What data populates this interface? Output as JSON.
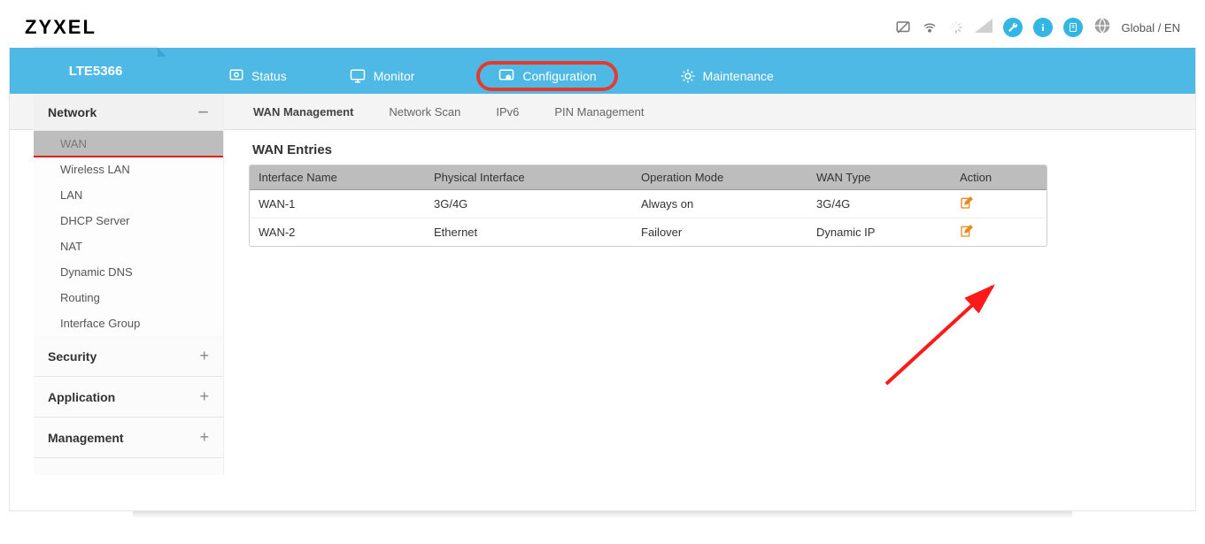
{
  "brand": "ZYXEL",
  "language": "Global / EN",
  "device_name": "LTE5366",
  "main_tabs": {
    "status": "Status",
    "monitor": "Monitor",
    "configuration": "Configuration",
    "maintenance": "Maintenance"
  },
  "sub_tabs": {
    "wan_management": "WAN Management",
    "network_scan": "Network Scan",
    "ipv6": "IPv6",
    "pin_management": "PIN Management"
  },
  "sidebar": {
    "network": {
      "label": "Network",
      "items": [
        "WAN",
        "Wireless LAN",
        "LAN",
        "DHCP Server",
        "NAT",
        "Dynamic DNS",
        "Routing",
        "Interface Group"
      ]
    },
    "security": {
      "label": "Security"
    },
    "application": {
      "label": "Application"
    },
    "management": {
      "label": "Management"
    }
  },
  "panel_title": "WAN Entries",
  "table": {
    "headers": {
      "iface": "Interface Name",
      "phys": "Physical Interface",
      "mode": "Operation Mode",
      "type": "WAN Type",
      "action": "Action"
    },
    "rows": [
      {
        "iface": "WAN-1",
        "phys": "3G/4G",
        "mode": "Always on",
        "type": "3G/4G"
      },
      {
        "iface": "WAN-2",
        "phys": "Ethernet",
        "mode": "Failover",
        "type": "Dynamic IP"
      }
    ]
  },
  "icons": {
    "status": "status-icon",
    "monitor": "monitor-icon",
    "configuration": "configuration-icon",
    "maintenance": "maintenance-icon",
    "edit": "edit-icon",
    "internet": "internet-icon",
    "wifi": "wifi-icon",
    "loading": "loading-icon",
    "signal": "signal-icon",
    "wrench": "wrench-icon",
    "info": "info-icon",
    "note": "note-icon",
    "globe": "globe-icon"
  }
}
